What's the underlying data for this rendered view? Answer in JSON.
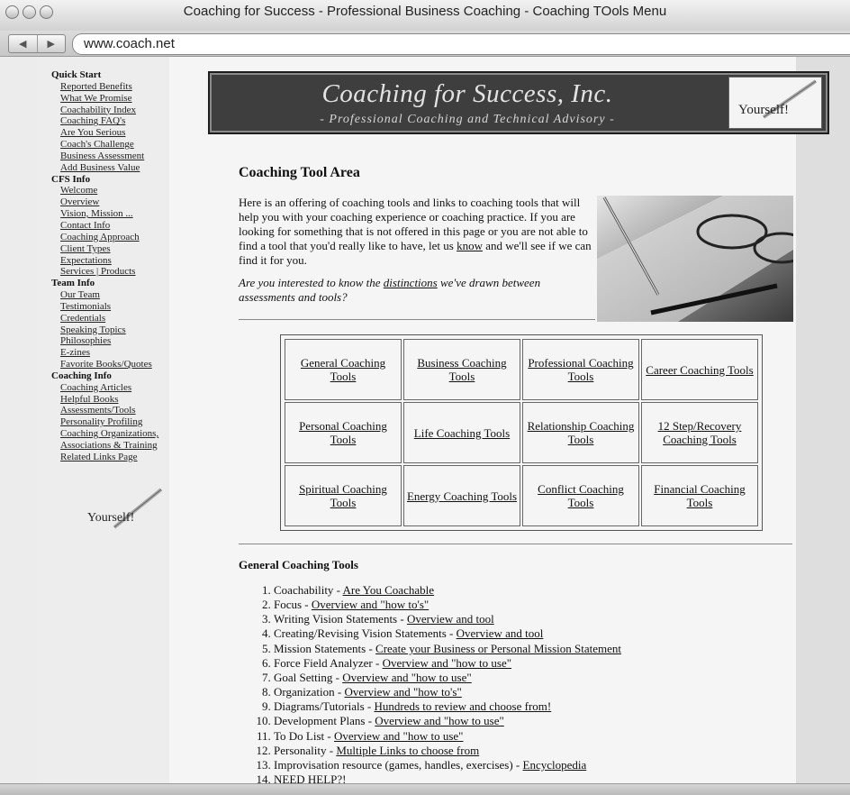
{
  "window": {
    "title": "Coaching for Success - Professional Business Coaching - Coaching TOols Menu",
    "url": "www.coach.net"
  },
  "banner": {
    "title": "Coaching for Success, Inc.",
    "subtitle": "- Professional Coaching and Technical Advisory -",
    "logo_text": "Yourself!"
  },
  "sidebar": {
    "logo_text": "Yourself!",
    "sections": [
      {
        "heading": "Quick Start",
        "items": [
          "Reported Benefits",
          "What We Promise",
          "Coachability Index",
          "Coaching FAQ's",
          "Are You Serious",
          "Coach's Challenge",
          "Business Assessment",
          "Add Business Value"
        ]
      },
      {
        "heading": "CFS Info",
        "items": [
          "Welcome",
          "Overview",
          "Vision, Mission ...",
          "Contact Info",
          "Coaching Approach",
          "Client Types",
          "Expectations",
          "Services | Products"
        ]
      },
      {
        "heading": "Team Info",
        "items": [
          "Our Team",
          "Testimonials",
          "Credentials",
          "Speaking Topics",
          "Philosophies",
          "E-zines",
          "Favorite Books/Quotes"
        ]
      },
      {
        "heading": "Coaching Info",
        "items": [
          "Coaching Articles",
          "Helpful Books",
          "Assessments/Tools",
          "Personality Profiling",
          "Coaching Organizations,",
          "Associations & Training",
          "Related Links Page"
        ]
      }
    ]
  },
  "main": {
    "heading": "Coaching Tool Area",
    "intro": {
      "p1_before": "Here is an offering of coaching tools and links to coaching tools that will help you with your coaching experience or coaching practice. If you are looking for something that is not offered in this page or you are not able to find a tool that you'd really like to have, let us ",
      "p1_link": "know",
      "p1_after": " and we'll see if we can find it for you.",
      "p2_before": "Are you interested to know the ",
      "p2_link": "distinctions",
      "p2_after": " we've drawn between assessments and tools?"
    },
    "grid": [
      [
        "General Coaching Tools",
        "Business Coaching Tools",
        "Professional Coaching Tools",
        "Career Coaching Tools"
      ],
      [
        "Personal Coaching Tools",
        "Life Coaching Tools",
        "Relationship Coaching Tools",
        "12 Step/Recovery Coaching Tools"
      ],
      [
        "Spiritual Coaching Tools",
        "Energy Coaching Tools",
        "Conflict Coaching Tools",
        "Financial Coaching Tools"
      ]
    ],
    "list_title": "General Coaching Tools",
    "list": [
      {
        "text": "Coachability - ",
        "link": "Are You Coachable"
      },
      {
        "text": "Focus - ",
        "link": "Overview and \"how to's\""
      },
      {
        "text": "Writing Vision Statements - ",
        "link": "Overview and tool"
      },
      {
        "text": "Creating/Revising Vision Statements - ",
        "link": "Overview and tool"
      },
      {
        "text": "Mission Statements - ",
        "link": "Create your Business or Personal Mission Statement"
      },
      {
        "text": "Force Field Analyzer - ",
        "link": "Overview and \"how to use\""
      },
      {
        "text": "Goal Setting - ",
        "link": "Overview and \"how to use\""
      },
      {
        "text": "Organization - ",
        "link": "Overview and \"how to's\""
      },
      {
        "text": "Diagrams/Tutorials - ",
        "link": "Hundreds to review and choose from!"
      },
      {
        "text": "Development Plans - ",
        "link": "Overview and \"how to use\""
      },
      {
        "text": "To Do List - ",
        "link": "Overview and \"how to use\""
      },
      {
        "text": "Personality - ",
        "link": "Multiple Links to choose from"
      },
      {
        "text": "Improvisation resource (games, handles, exercises) - ",
        "link": "Encyclopedia"
      },
      {
        "text": "NEED HELP?!",
        "link": ""
      }
    ]
  }
}
